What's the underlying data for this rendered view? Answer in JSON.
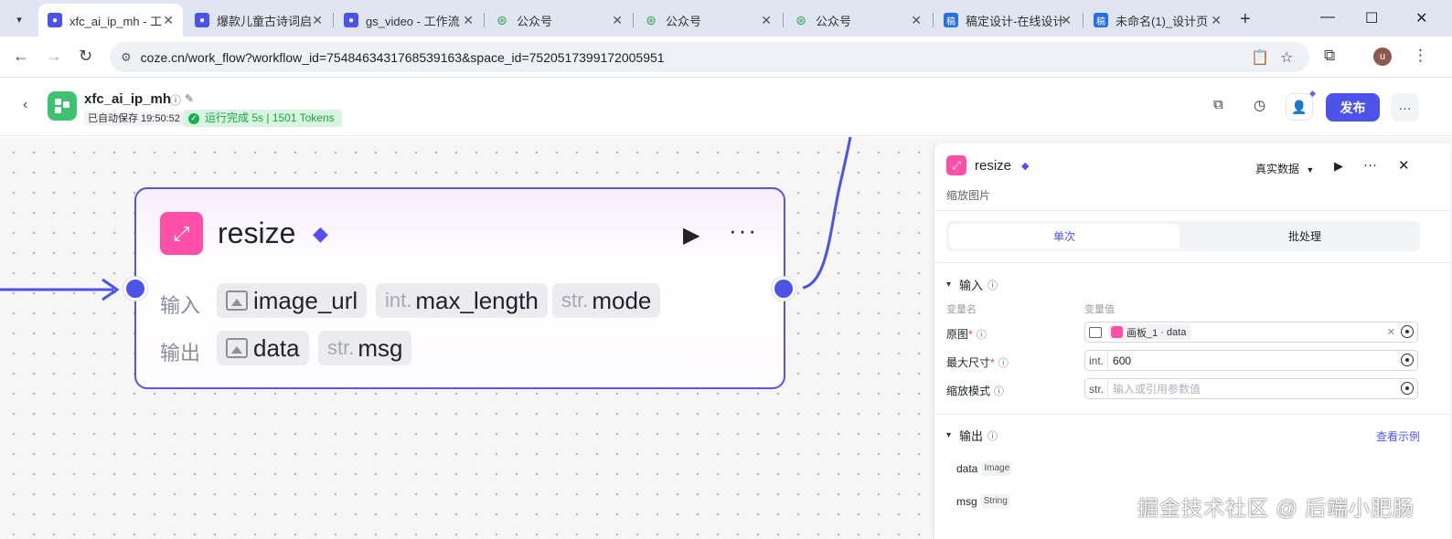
{
  "browser": {
    "tabs": [
      {
        "title": "xfc_ai_ip_mh - 工",
        "active": true
      },
      {
        "title": "爆款儿童古诗词启"
      },
      {
        "title": "gs_video - 工作流"
      },
      {
        "title": "公众号"
      },
      {
        "title": "公众号"
      },
      {
        "title": "公众号"
      },
      {
        "title": "稿定设计-在线设计"
      },
      {
        "title": "未命名(1)_设计页"
      }
    ],
    "url": "coze.cn/work_flow?workflow_id=7548463431768539163&space_id=7520517399172005951",
    "profile_initial": "u"
  },
  "header": {
    "app_name": "xfc_ai_ip_mh",
    "saved_text": "已自动保存 19:50:52",
    "run_status": "运行完成 5s | 1501 Tokens",
    "publish_label": "发布"
  },
  "node": {
    "title": "resize",
    "input_label": "输入",
    "output_label": "输出",
    "inputs": [
      {
        "prefix": "",
        "name": "image_url",
        "icon": "image-icon"
      },
      {
        "prefix": "int.",
        "name": "max_length"
      },
      {
        "prefix": "str.",
        "name": "mode"
      }
    ],
    "outputs": [
      {
        "prefix": "",
        "name": "data",
        "icon": "image-icon"
      },
      {
        "prefix": "str.",
        "name": "msg"
      }
    ]
  },
  "panel": {
    "title": "resize",
    "description": "缩放图片",
    "data_mode": "真实数据",
    "tabs": {
      "single": "单次",
      "batch": "批处理"
    },
    "input_section": "输入",
    "col_name": "变量名",
    "col_value": "变量值",
    "params": [
      {
        "label": "原图",
        "required": true,
        "ref_prefix": "画板_1",
        "ref_field": "data"
      },
      {
        "label": "最大尺寸",
        "required": true,
        "type": "int.",
        "value": "600"
      },
      {
        "label": "缩放模式",
        "required": false,
        "type": "str.",
        "placeholder": "输入或引用参数值"
      }
    ],
    "output_section": "输出",
    "view_example": "查看示例",
    "outputs": [
      {
        "name": "data",
        "type": "Image"
      },
      {
        "name": "msg",
        "type": "String"
      }
    ]
  },
  "watermark": "掘金技术社区 @ 后端小肥肠",
  "colors": {
    "accent": "#4d53e8",
    "node_icon": "#ff4fa6",
    "success": "#1aad54"
  }
}
